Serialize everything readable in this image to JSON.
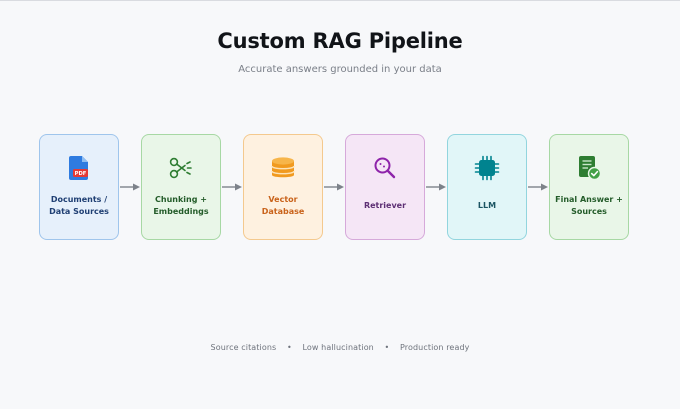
{
  "header": {
    "title": "Custom RAG Pipeline",
    "subtitle": "Accurate answers grounded in your data"
  },
  "steps": [
    {
      "label": "Documents /\nData Sources",
      "icon": "pdf-document-icon",
      "fill": "#e6f0fb",
      "border": "#9fc5ec",
      "text": "#1f3f73"
    },
    {
      "label": "Chunking +\nEmbeddings",
      "icon": "scissors-icon",
      "fill": "#e9f6e8",
      "border": "#a7d8a4",
      "text": "#245c2a"
    },
    {
      "label": "Vector\nDatabase",
      "icon": "database-icon",
      "fill": "#fef1e0",
      "border": "#f4c98e",
      "text": "#c9631b"
    },
    {
      "label": "Retriever",
      "icon": "search-icon",
      "fill": "#f5e6f6",
      "border": "#d6a9da",
      "text": "#5d2f74"
    },
    {
      "label": "LLM",
      "icon": "ai-chip-icon",
      "fill": "#e1f6f8",
      "border": "#92d5de",
      "text": "#1b5563"
    },
    {
      "label": "Final Answer +\nSources",
      "icon": "checked-document-icon",
      "fill": "#e9f6e8",
      "border": "#a7d8a4",
      "text": "#245c2a"
    }
  ],
  "footer": {
    "items": [
      "Source citations",
      "Low hallucination",
      "Production ready"
    ],
    "separator": "•"
  }
}
